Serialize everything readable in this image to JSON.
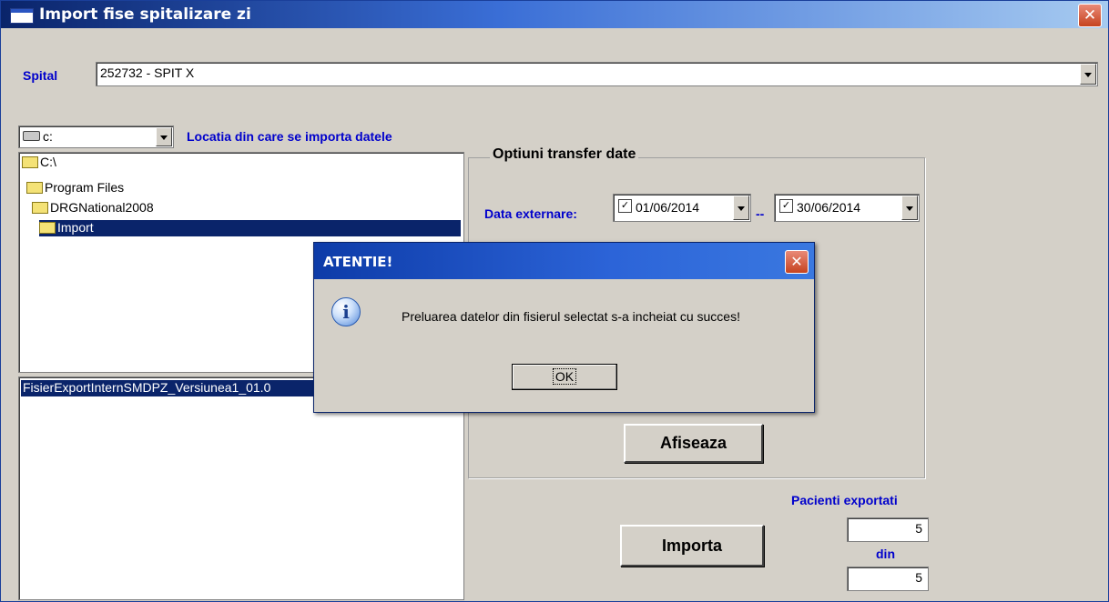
{
  "window": {
    "title": "Import fise spitalizare zi",
    "close_symbol": "✕"
  },
  "spital": {
    "label": "Spital",
    "value": "252732 - SPIT X"
  },
  "drive": {
    "value": "c:",
    "icon": "drive-icon"
  },
  "location_label": "Locatia din care se importa datele",
  "folders": [
    {
      "name": "C:\\",
      "icon": "open-folder-icon"
    },
    {
      "name": "Program Files",
      "icon": "open-folder-icon"
    },
    {
      "name": "DRGNational2008",
      "icon": "open-folder-icon"
    },
    {
      "name": "Import",
      "icon": "open-folder-icon",
      "selected": true
    }
  ],
  "files": [
    {
      "name": "FisierExportInternSMDPZ_Versiunea1_01.0",
      "selected": true
    }
  ],
  "options": {
    "group_label": "Optiuni transfer date",
    "data_externare_label": "Data externare:",
    "date_from": "01/06/2014",
    "date_separator": "--",
    "date_to": "30/06/2014",
    "check_mark": "✓",
    "afiseaza_label": "Afiseaza"
  },
  "import": {
    "button_label": "Importa",
    "pacienti_label": "Pacienti exportati",
    "exported_count": "5",
    "din_label": "din",
    "total_count": "5"
  },
  "dialog": {
    "title": "ATENTIE!",
    "close_symbol": "✕",
    "icon_glyph": "i",
    "message": "Preluarea datelor din fisierul selectat s-a incheiat cu succes!",
    "ok_label": "OK"
  }
}
